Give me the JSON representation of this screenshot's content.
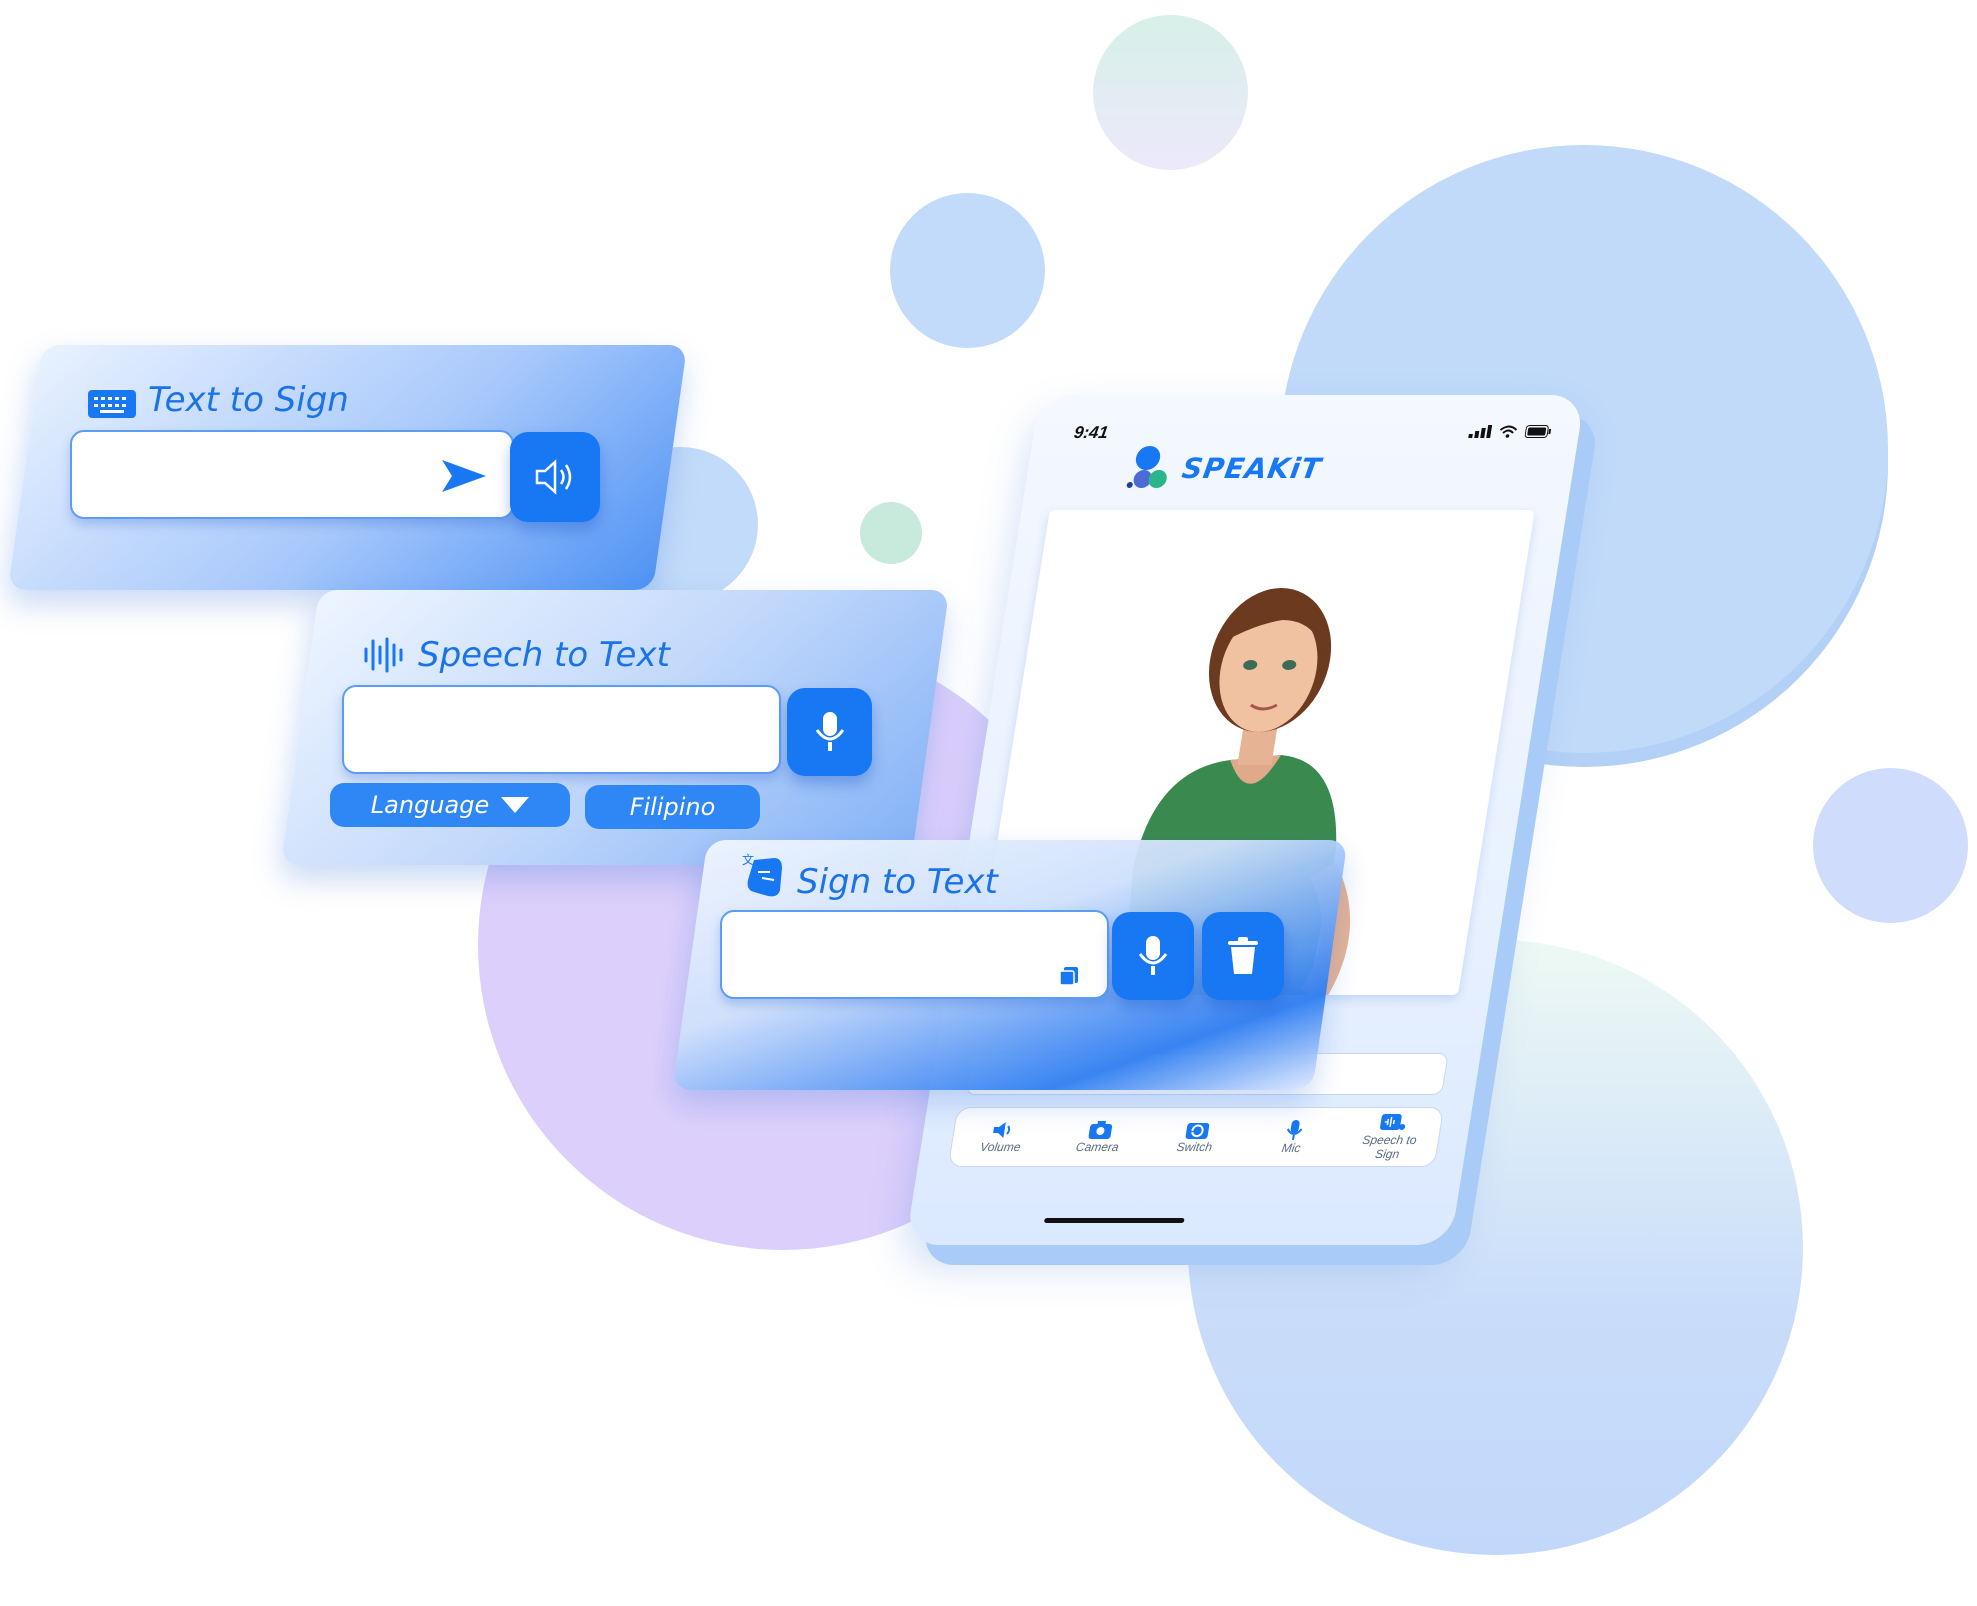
{
  "text_to_sign": {
    "title": "Text to Sign",
    "icons": {
      "header": "keyboard-icon",
      "send": "send-icon",
      "speaker": "speaker-icon"
    }
  },
  "speech_to_text": {
    "title": "Speech to Text",
    "language_label": "Language",
    "language_value": "Filipino",
    "icons": {
      "header": "waveform-icon",
      "mic": "microphone-icon",
      "dropdown": "caret-down-icon"
    }
  },
  "sign_to_text": {
    "title": "Sign to Text",
    "icons": {
      "header": "sign-language-icon",
      "copy": "copy-icon",
      "mic": "microphone-icon",
      "delete": "trash-icon"
    }
  },
  "phone": {
    "time": "9:41",
    "app_name": "SPEAKiT",
    "nav": [
      {
        "label": "Volume",
        "icon": "volume-icon"
      },
      {
        "label": "Camera",
        "icon": "camera-icon"
      },
      {
        "label": "Switch",
        "icon": "switch-camera-icon"
      },
      {
        "label": "Mic",
        "icon": "microphone-icon"
      },
      {
        "label": "Speech to Sign",
        "icon": "speech-to-sign-icon"
      }
    ]
  },
  "colors": {
    "primary": "#1877f2",
    "bubble_blue": "#c6ddfb",
    "bubble_purple": "#dccffb",
    "bubble_green": "#cdeee0"
  }
}
